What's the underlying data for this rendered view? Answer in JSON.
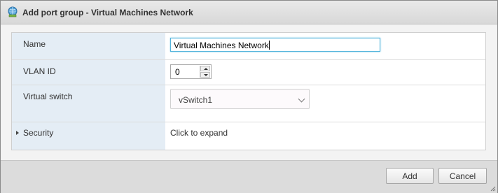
{
  "dialog": {
    "title": "Add port group - Virtual Machines Network",
    "title_icon": "network-portgroup-icon"
  },
  "form": {
    "name": {
      "label": "Name",
      "value": "Virtual Machines Network"
    },
    "vlan": {
      "label": "VLAN ID",
      "value": "0"
    },
    "vswitch": {
      "label": "Virtual switch",
      "value": "vSwitch1"
    },
    "security": {
      "label": "Security",
      "value": "Click to expand"
    }
  },
  "footer": {
    "add_label": "Add",
    "cancel_label": "Cancel"
  },
  "colors": {
    "label_column": "#e4edf5",
    "focus_border": "#55b5dc"
  }
}
